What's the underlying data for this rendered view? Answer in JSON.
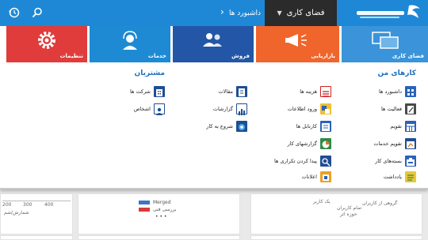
{
  "header": {
    "workspace_tab": "فضای کاری",
    "dashboards_tab": "داشبورد ها",
    "colors": {
      "bar": "#1e88d6",
      "active_tab": "#2b2b2b"
    }
  },
  "tiles": [
    {
      "label": "فضای کاری",
      "color": "#3b94d9",
      "icon": "monitor-icon"
    },
    {
      "label": "بازاریابی",
      "color": "#f0652c",
      "icon": "megaphone-icon"
    },
    {
      "label": "فروش",
      "color": "#2356a6",
      "icon": "users-icon"
    },
    {
      "label": "خدمات",
      "color": "#1e8ad3",
      "icon": "headset-icon"
    },
    {
      "label": "تنظیمات",
      "color": "#e03c3b",
      "icon": "gear-icon"
    }
  ],
  "my_work": {
    "title": "کارهای من",
    "col1": [
      {
        "label": "داشبورد ها",
        "icon": "dashboard-icon"
      },
      {
        "label": "فعالیت ها",
        "icon": "activity-icon"
      },
      {
        "label": "تقویم",
        "icon": "calendar-icon"
      },
      {
        "label": "تقویم خدمات",
        "icon": "service-calendar-icon"
      },
      {
        "label": "بسته‌های کار",
        "icon": "work-package-icon"
      },
      {
        "label": "یادداشت",
        "icon": "note-icon"
      }
    ],
    "col2": [
      {
        "label": "هزینه ها",
        "icon": "expense-icon"
      },
      {
        "label": "ورود اطلاعات",
        "icon": "data-entry-icon"
      },
      {
        "label": "کارتابل ها",
        "icon": "cartable-icon"
      },
      {
        "label": "گزارشهای کار",
        "icon": "work-report-icon"
      },
      {
        "label": "پیدا کردن تکراری ها",
        "icon": "find-duplicates-icon"
      },
      {
        "label": "اعلانات",
        "icon": "notification-icon"
      }
    ],
    "col3": [
      {
        "label": "مقالات",
        "icon": "article-icon"
      },
      {
        "label": "گزارشات",
        "icon": "report-icon"
      },
      {
        "label": "شروع به کار",
        "icon": "start-work-icon"
      }
    ]
  },
  "customers": {
    "title": "مشتریان",
    "items": [
      {
        "label": "شرکت ها",
        "icon": "company-icon"
      },
      {
        "label": "اشخاص",
        "icon": "contacts-icon"
      }
    ]
  },
  "dashboard_preview": {
    "axis_ticks": [
      "400",
      "300",
      "200"
    ],
    "axis_caption": "شمارش/شم",
    "legend": [
      {
        "label": "Merged",
        "color": "#3a76c4"
      },
      {
        "label": "بررسی فنی",
        "color": "#d93a3a"
      }
    ],
    "ellipsis": "• • •",
    "card3_lines": [
      "یک کاربر",
      "تمام کاربران",
      "حوزه اثر"
    ],
    "card4_line": "گروهی از کاربران"
  }
}
